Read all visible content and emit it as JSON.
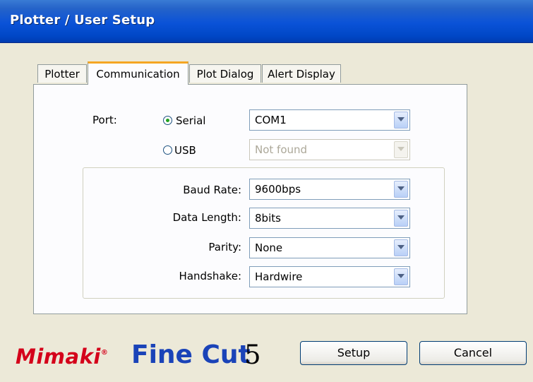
{
  "window": {
    "title": "Plotter / User Setup"
  },
  "tabs": [
    {
      "label": "Plotter",
      "active": false
    },
    {
      "label": "Communication",
      "active": true
    },
    {
      "label": "Plot Dialog",
      "active": false
    },
    {
      "label": "Alert Display",
      "active": false
    }
  ],
  "port": {
    "label": "Port:",
    "serial": {
      "label": "Serial",
      "checked": true,
      "value": "COM1"
    },
    "usb": {
      "label": "USB",
      "checked": false,
      "value": "Not found",
      "disabled": true
    }
  },
  "settings": [
    {
      "label": "Baud Rate:",
      "value": "9600bps"
    },
    {
      "label": "Data Length:",
      "value": "8bits"
    },
    {
      "label": "Parity:",
      "value": "None"
    },
    {
      "label": "Handshake:",
      "value": "Hardwire"
    }
  ],
  "buttons": {
    "setup": "Setup",
    "cancel": "Cancel"
  },
  "branding": {
    "mimaki": "Mimaki",
    "finecut": "Fine Cut",
    "version": "5"
  },
  "colors": {
    "title_bar": "#0a52d8",
    "active_tab_accent": "#f5a623",
    "mimaki_red": "#d4001a",
    "finecut_blue": "#1a43b8",
    "radio_dot": "#21a121"
  }
}
